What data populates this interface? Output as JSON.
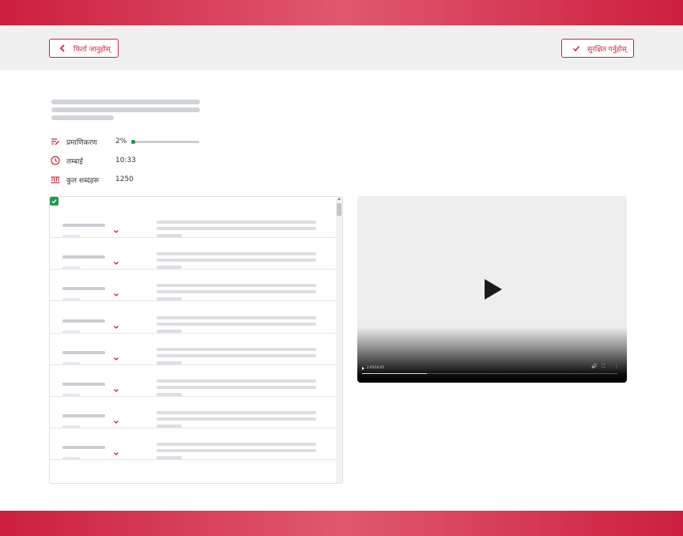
{
  "header": {
    "back_label": "फिर्ता जानुहोस्",
    "save_label": "सुरक्षित गर्नुहोस्"
  },
  "meta": {
    "authentication": {
      "label": "प्रमाणिकरण",
      "value": "2%",
      "progress": 0.02
    },
    "length": {
      "label": "लम्बाई",
      "value": "10:33"
    },
    "word_count": {
      "label": "कुल शब्दहरू",
      "value": "1250"
    }
  },
  "list": {
    "selected": true,
    "rows": 8
  },
  "video": {
    "time": "2:45/10:45",
    "played_fraction": 0.255
  },
  "colors": {
    "accent": "#cc1f3e",
    "success": "#1f9a4a",
    "placeholder": "#d0d3d8"
  }
}
